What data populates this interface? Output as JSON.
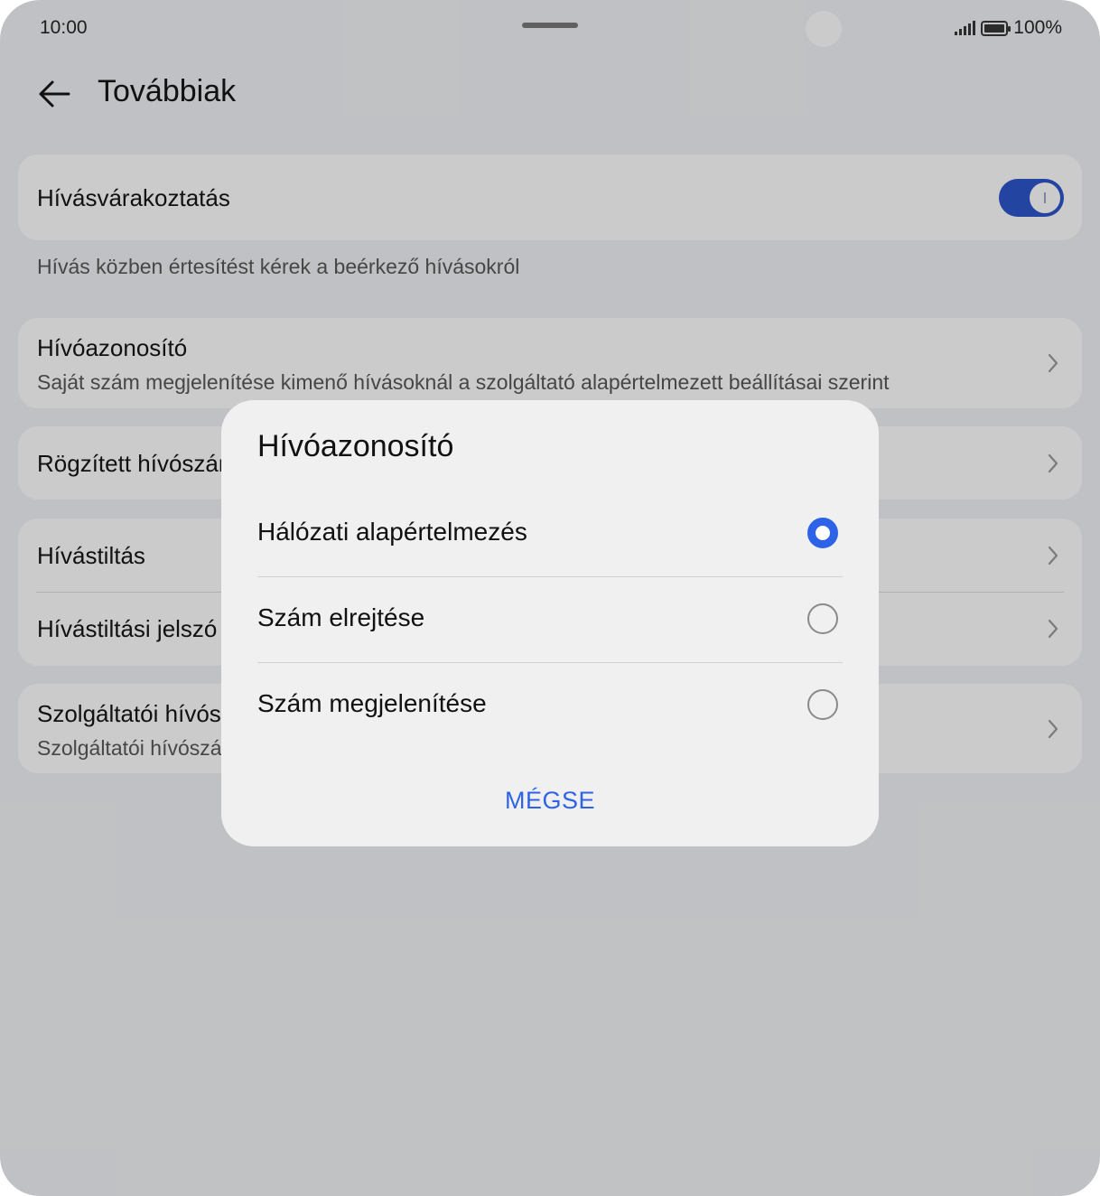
{
  "status_bar": {
    "time": "10:00",
    "battery": "100%"
  },
  "header": {
    "title": "Továbbiak"
  },
  "settings": {
    "call_waiting": {
      "title": "Hívásvárakoztatás",
      "enabled": true,
      "helper": "Hívás közben értesítést kérek a beérkező hívásokról"
    },
    "caller_id": {
      "title": "Hívóazonosító",
      "subtitle": "Saját szám megjelenítése kimenő hívásoknál a szolgáltató alapértelmezett beállításai szerint"
    },
    "fixed_dialing": {
      "title": "Rögzített hívószámok"
    },
    "call_barring": {
      "title": "Hívástiltás"
    },
    "call_barring_password": {
      "title": "Hívástiltási jelszó"
    },
    "service_numbers": {
      "title": "Szolgáltatói hívószámok",
      "subtitle": "Szolgáltatói hívószámok"
    }
  },
  "dialog": {
    "title": "Hívóazonosító",
    "options": [
      {
        "label": "Hálózati alapértelmezés",
        "selected": true
      },
      {
        "label": "Szám elrejtése",
        "selected": false
      },
      {
        "label": "Szám megjelenítése",
        "selected": false
      }
    ],
    "cancel_label": "MÉGSE"
  },
  "colors": {
    "accent": "#2e63e8",
    "toggle_on": "#2a52c9"
  }
}
